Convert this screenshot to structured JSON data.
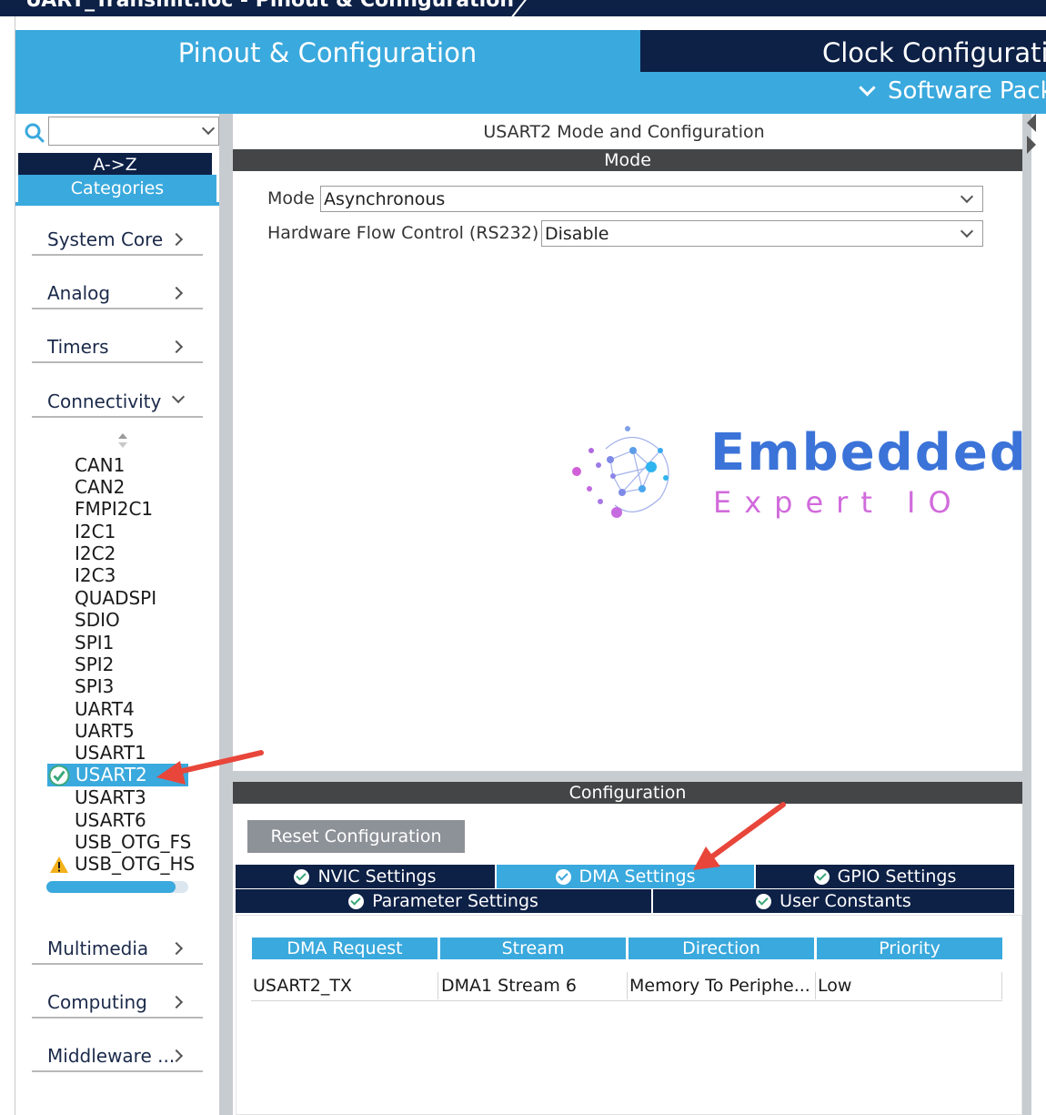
{
  "window": {
    "title_fragment": "UART_Transmit.ioc - Pinout & Configuration"
  },
  "top_tabs": {
    "pinout": "Pinout & Configuration",
    "clock": "Clock Configuratio",
    "software_packs": "Software Pack"
  },
  "left": {
    "search_placeholder": "",
    "az_label": "A->Z",
    "categories_label": "Categories",
    "categories": [
      {
        "label": "System Core"
      },
      {
        "label": "Analog"
      },
      {
        "label": "Timers"
      },
      {
        "label": "Connectivity"
      },
      {
        "label": "Multimedia"
      },
      {
        "label": "Computing"
      },
      {
        "label": "Middleware ..."
      }
    ],
    "peripherals": [
      "CAN1",
      "CAN2",
      "FMPI2C1",
      "I2C1",
      "I2C2",
      "I2C3",
      "QUADSPI",
      "SDIO",
      "SPI1",
      "SPI2",
      "SPI3",
      "UART4",
      "UART5",
      "USART1",
      "USART2",
      "USART3",
      "USART6",
      "USB_OTG_FS",
      "USB_OTG_HS"
    ],
    "selected_peripheral": "USART2",
    "progress_fraction": 0.91
  },
  "main": {
    "title": "USART2 Mode and Configuration",
    "mode_section": "Mode",
    "mode_label": "Mode",
    "mode_value": "Asynchronous",
    "hw_flow_label": "Hardware Flow Control (RS232)",
    "hw_flow_value": "Disable",
    "logo_word1": "Embedded",
    "logo_word2": "Expert IO",
    "config_section": "Configuration",
    "reset_button": "Reset Configuration",
    "tabs_row1": [
      "NVIC Settings",
      "DMA Settings",
      "GPIO Settings"
    ],
    "tabs_row2": [
      "Parameter Settings",
      "User Constants"
    ],
    "active_tab": "DMA Settings",
    "table_headers": [
      "DMA Request",
      "Stream",
      "Direction",
      "Priority"
    ],
    "table_rows": [
      [
        "USART2_TX",
        "DMA1 Stream 6",
        "Memory To Periphe...",
        "Low"
      ]
    ]
  },
  "colors": {
    "accent": "#3aa9dd",
    "navy": "#0d2046",
    "section_bar": "#434547",
    "annotation_arrow": "#e8463a"
  }
}
